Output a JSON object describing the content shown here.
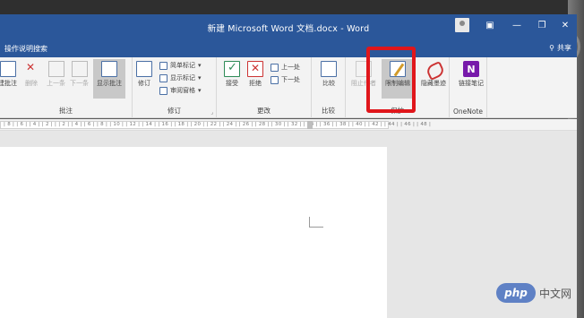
{
  "window": {
    "title": "新建 Microsoft Word 文档.docx - Word",
    "minimize": "—",
    "restore": "❐",
    "close": "✕"
  },
  "tellme": {
    "placeholder": "操作说明搜索",
    "share": "共享"
  },
  "ribbon": {
    "groups": {
      "comments": {
        "label": "批注",
        "buttons": {
          "new_comment": "建批注",
          "delete": "删除",
          "previous": "上一条",
          "next": "下一条",
          "show_comments": "显示批注"
        }
      },
      "tracking": {
        "label": "修订",
        "track_changes": "修订",
        "markup": "简单标记",
        "show_markup": "显示标记",
        "reviewing_pane": "审阅窗格"
      },
      "changes": {
        "label": "更改",
        "accept": "接受",
        "reject": "拒绝",
        "previous": "上一处",
        "next": "下一处"
      },
      "compare": {
        "label": "比较",
        "compare": "比较"
      },
      "protect": {
        "label": "保护",
        "block_authors": "阻止作者",
        "restrict_editing": "限制编辑",
        "ink": "隐藏墨迹"
      },
      "onenote": {
        "label": "OneNote",
        "linked_notes": "链接笔记"
      }
    }
  },
  "ruler": {
    "ticks": "| 8 | | 6 | | 4 | | 2 | | | 2 | | 4 | | 6 | | 8 | | 10 | | 12 | | 14 | | 16 | | 18 | | 20 | | 22 | | 24 | | 26 | | 28 | | 30 | | 32 | | 34 | | 36 | | 38 | | 40 | | 42 | | 44 | | 46 | | 48 |"
  },
  "watermark": {
    "logo": "php",
    "text": "中文网"
  },
  "colors": {
    "word_blue": "#2b579a",
    "highlight_red": "#e0161b"
  }
}
